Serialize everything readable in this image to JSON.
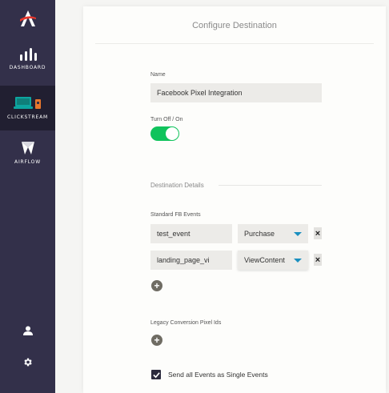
{
  "sidebar": {
    "items": [
      {
        "label": "DASHBOARD",
        "icon": "bar-chart-icon"
      },
      {
        "label": "CLICKSTREAM",
        "icon": "clickstream-icon"
      },
      {
        "label": "AIRFLOW",
        "icon": "airflow-icon"
      }
    ],
    "logo_icon": "logo-icon",
    "bottom_icons": [
      "user-icon",
      "gear-icon"
    ]
  },
  "panel": {
    "title": "Configure Destination",
    "name_label": "Name",
    "name_value": "Facebook Pixel Integration",
    "toggle_label": "Turn Off / On",
    "toggle_on": true,
    "destination_details_label": "Destination Details",
    "standard_events_label": "Standard FB Events",
    "events": [
      {
        "name": "test_event",
        "type": "Purchase"
      },
      {
        "name": "landing_page_vi",
        "type": "ViewContent"
      }
    ],
    "legacy_label": "Legacy Conversion Pixel Ids",
    "send_single_label": "Send all Events as Single Events",
    "send_single_checked": true
  },
  "colors": {
    "sidebar_bg": "#33304a",
    "sidebar_active": "#211f31",
    "toggle_green": "#10c35c",
    "caret_blue": "#1a8fbf",
    "logo_red": "#e8372c"
  }
}
